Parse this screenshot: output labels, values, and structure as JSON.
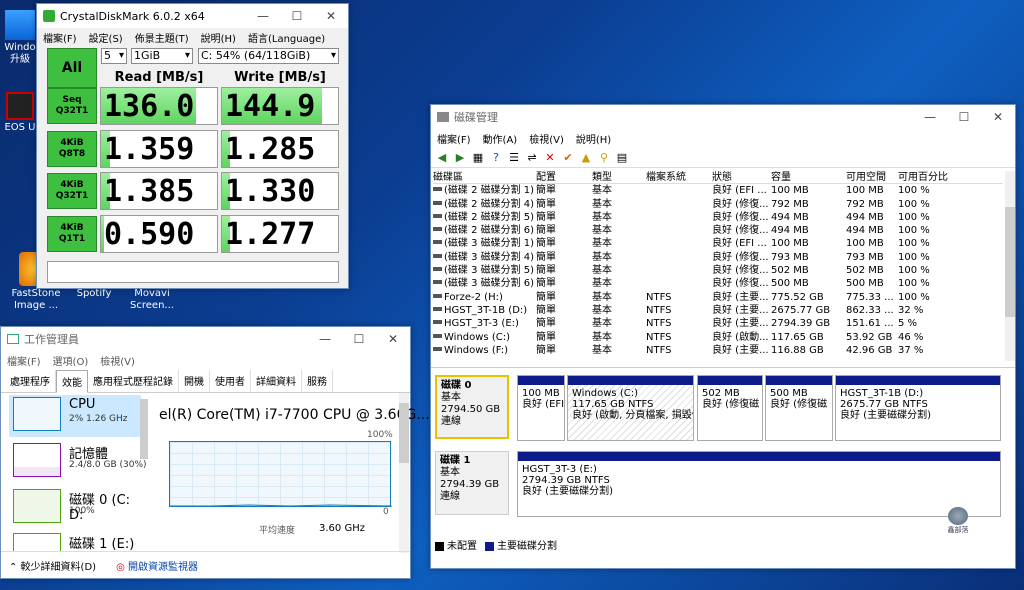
{
  "desktop": {
    "icons": [
      {
        "label": "Windo\n升級",
        "name": "windows-upgrade"
      },
      {
        "label": "EOS U",
        "name": "eos-utility"
      },
      {
        "label": "FastStone Image ...",
        "name": "faststone"
      },
      {
        "label": "Spotify",
        "name": "spotify"
      },
      {
        "label": "Movavi Screen...",
        "name": "movavi"
      }
    ]
  },
  "cdm": {
    "title": "CrystalDiskMark 6.0.2 x64",
    "menu": [
      "檔案(F)",
      "設定(S)",
      "佈景主題(T)",
      "說明(H)",
      "語言(Language)"
    ],
    "all_button": "All",
    "count": "5",
    "size": "1GiB",
    "drive": "C: 54% (64/118GiB)",
    "read_header": "Read [MB/s]",
    "write_header": "Write [MB/s]",
    "rows": [
      {
        "label1": "Seq",
        "label2": "Q32T1",
        "read": "136.0",
        "write": "144.9",
        "read_fill": 0.82,
        "write_fill": 0.86
      },
      {
        "label1": "4KiB",
        "label2": "Q8T8",
        "read": "1.359",
        "write": "1.285",
        "read_fill": 0.08,
        "write_fill": 0.07
      },
      {
        "label1": "4KiB",
        "label2": "Q32T1",
        "read": "1.385",
        "write": "1.330",
        "read_fill": 0.08,
        "write_fill": 0.07
      },
      {
        "label1": "4KiB",
        "label2": "Q1T1",
        "read": "0.590",
        "write": "1.277",
        "read_fill": 0.03,
        "write_fill": 0.07
      }
    ]
  },
  "taskmgr": {
    "title": "工作管理員",
    "menu": [
      "檔案(F)",
      "選項(O)",
      "檢視(V)"
    ],
    "tabs": [
      "處理程序",
      "效能",
      "應用程式歷程記錄",
      "開機",
      "使用者",
      "詳細資料",
      "服務"
    ],
    "active_tab": 1,
    "items": [
      {
        "name": "CPU",
        "sub": "2%  1.26 GHz",
        "color": "#117dbb"
      },
      {
        "name": "記憶體",
        "sub": "2.4/8.0 GB (30%)",
        "color": "#8b12ae"
      },
      {
        "name": "磁碟 0 (C: D:",
        "sub": "100%",
        "color": "#4da60c"
      },
      {
        "name": "磁碟 1 (E:)",
        "sub": "",
        "color": "#4da60c"
      }
    ],
    "cpu_model": "el(R) Core(TM) i7-7700 CPU @ 3.60G...",
    "graph_max": "100%",
    "graph_min": "0",
    "speed_label": "平均速度",
    "speed_value": "3.60 GHz",
    "fewer_details": "較少詳細資料(D)",
    "resource_monitor": "開啟資源監視器"
  },
  "diskmgmt": {
    "title": "磁碟管理",
    "menu": [
      "檔案(F)",
      "動作(A)",
      "檢視(V)",
      "說明(H)"
    ],
    "columns": [
      "磁碟區",
      "配置",
      "類型",
      "檔案系統",
      "狀態",
      "容量",
      "可用空間",
      "可用百分比"
    ],
    "rows": [
      [
        "(磁碟 2 磁碟分割 1)",
        "簡單",
        "基本",
        "",
        "良好 (EFI ...",
        "100 MB",
        "100 MB",
        "100 %"
      ],
      [
        "(磁碟 2 磁碟分割 4)",
        "簡單",
        "基本",
        "",
        "良好 (修復...",
        "792 MB",
        "792 MB",
        "100 %"
      ],
      [
        "(磁碟 2 磁碟分割 5)",
        "簡單",
        "基本",
        "",
        "良好 (修復...",
        "494 MB",
        "494 MB",
        "100 %"
      ],
      [
        "(磁碟 2 磁碟分割 6)",
        "簡單",
        "基本",
        "",
        "良好 (修復...",
        "494 MB",
        "494 MB",
        "100 %"
      ],
      [
        "(磁碟 3 磁碟分割 1)",
        "簡單",
        "基本",
        "",
        "良好 (EFI ...",
        "100 MB",
        "100 MB",
        "100 %"
      ],
      [
        "(磁碟 3 磁碟分割 4)",
        "簡單",
        "基本",
        "",
        "良好 (修復...",
        "793 MB",
        "793 MB",
        "100 %"
      ],
      [
        "(磁碟 3 磁碟分割 5)",
        "簡單",
        "基本",
        "",
        "良好 (修復...",
        "502 MB",
        "502 MB",
        "100 %"
      ],
      [
        "(磁碟 3 磁碟分割 6)",
        "簡單",
        "基本",
        "",
        "良好 (修復...",
        "500 MB",
        "500 MB",
        "100 %"
      ],
      [
        "Forze-2 (H:)",
        "簡單",
        "基本",
        "NTFS",
        "良好 (主要...",
        "775.52 GB",
        "775.33 ...",
        "100 %"
      ],
      [
        "HGST_3T-1B (D:)",
        "簡單",
        "基本",
        "NTFS",
        "良好 (主要...",
        "2675.77 GB",
        "862.33 ...",
        "32 %"
      ],
      [
        "HGST_3T-3 (E:)",
        "簡單",
        "基本",
        "NTFS",
        "良好 (主要...",
        "2794.39 GB",
        "151.61 ...",
        "5 %"
      ],
      [
        "Windows (C:)",
        "簡單",
        "基本",
        "NTFS",
        "良好 (啟動...",
        "117.65 GB",
        "53.92 GB",
        "46 %"
      ],
      [
        "Windows (F:)",
        "簡單",
        "基本",
        "NTFS",
        "良好 (主要...",
        "116.88 GB",
        "42.96 GB",
        "37 %"
      ]
    ],
    "disk0": {
      "name": "磁碟 0",
      "type": "基本",
      "size": "2794.50 GB",
      "status": "連線",
      "parts": [
        {
          "title": "",
          "l1": "100 MB",
          "l2": "良好 (EFI"
        },
        {
          "title": "Windows (C:)",
          "l1": "117.65 GB NTFS",
          "l2": "良好 (啟動, 分頁檔案, 損毀傾"
        },
        {
          "title": "",
          "l1": "502 MB",
          "l2": "良好 (修復磁"
        },
        {
          "title": "",
          "l1": "500 MB",
          "l2": "良好 (修復磁"
        },
        {
          "title": "HGST_3T-1B (D:)",
          "l1": "2675.77 GB NTFS",
          "l2": "良好 (主要磁碟分割)"
        }
      ]
    },
    "disk1": {
      "name": "磁碟 1",
      "type": "基本",
      "size": "2794.39 GB",
      "status": "連線",
      "parts": [
        {
          "title": "HGST_3T-3 (E:)",
          "l1": "2794.39 GB NTFS",
          "l2": "良好 (主要磁碟分割)"
        }
      ]
    },
    "legend": [
      "未配置",
      "主要磁碟分割"
    ]
  },
  "watermark": "鑫部落"
}
